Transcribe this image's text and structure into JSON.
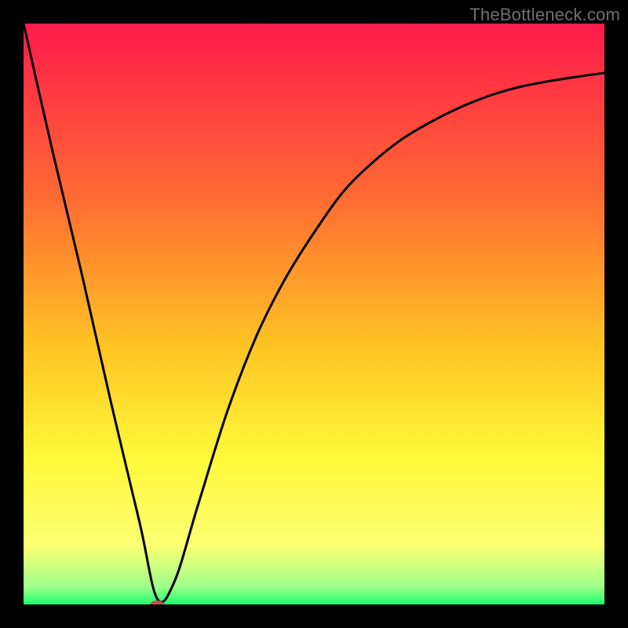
{
  "watermark": "TheBottleneck.com",
  "chart_data": {
    "type": "line",
    "title": "",
    "xlabel": "",
    "ylabel": "",
    "xlim": [
      0,
      100
    ],
    "ylim": [
      0,
      100
    ],
    "legend": false,
    "grid": false,
    "background_gradient": {
      "stops": [
        {
          "offset": 0.0,
          "color": "#ff1a4b"
        },
        {
          "offset": 0.3,
          "color": "#ff6b33"
        },
        {
          "offset": 0.55,
          "color": "#ffc223"
        },
        {
          "offset": 0.75,
          "color": "#fff93a"
        },
        {
          "offset": 0.9,
          "color": "#fbff73"
        },
        {
          "offset": 0.97,
          "color": "#9dff8a"
        },
        {
          "offset": 1.0,
          "color": "#1bff6e"
        }
      ]
    },
    "series": [
      {
        "name": "bottleneck-curve",
        "x": [
          0,
          5,
          10,
          15,
          20,
          23,
          26,
          30,
          35,
          40,
          45,
          50,
          55,
          60,
          65,
          70,
          75,
          80,
          85,
          90,
          95,
          100
        ],
        "y": [
          100,
          78,
          57,
          35,
          14,
          1,
          4,
          17,
          33,
          46,
          56,
          64,
          71,
          76,
          80,
          83,
          85.5,
          87.5,
          89,
          90,
          90.8,
          91.5
        ]
      }
    ],
    "marker": {
      "name": "optimal-point",
      "x": 23,
      "y": 0,
      "color": "#c94b4b",
      "rx": 9,
      "ry": 5
    }
  }
}
